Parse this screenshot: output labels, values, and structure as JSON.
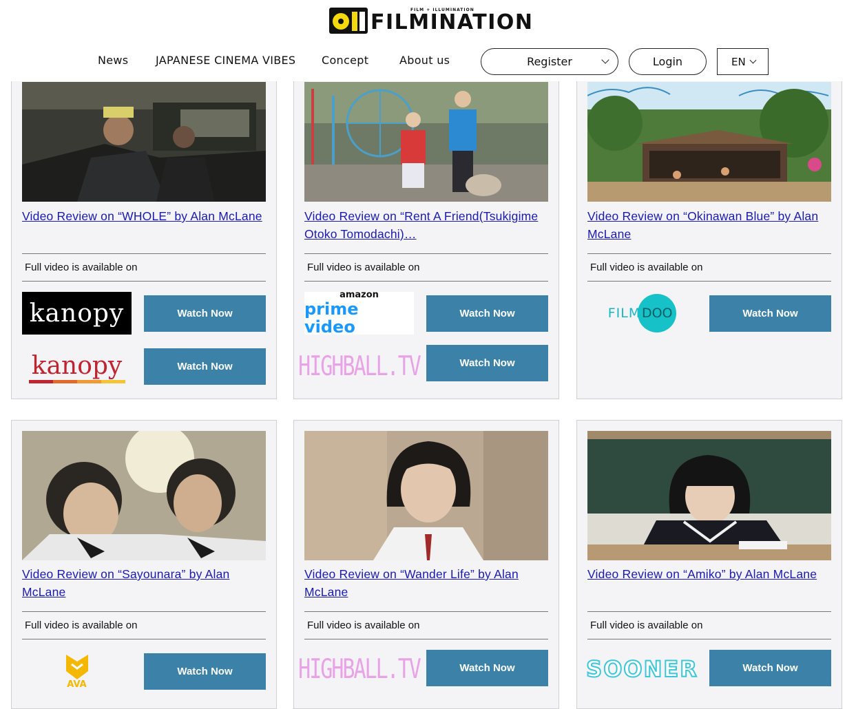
{
  "header": {
    "logo_sub": "FILM + ILLUMINATION",
    "logo_main": "FILMINATION",
    "nav": [
      "News",
      "JAPANESE CINEMA VIBES",
      "Concept",
      "About us"
    ],
    "register_label": "Register",
    "login_label": "Login",
    "lang_label": "EN"
  },
  "cards": [
    {
      "title": "Video Review on “WHOLE” by Alan McLane",
      "avail": "Full video is available on",
      "providers": [
        {
          "name": "kanopy",
          "label": "kanopy",
          "watch": "Watch Now"
        },
        {
          "name": "kanopy",
          "label": "kanopy",
          "watch": "Watch Now"
        }
      ]
    },
    {
      "title": "Video Review on “Rent A Friend(Tsukigime Otoko Tomodachi)…",
      "avail": "Full video is available on",
      "providers": [
        {
          "name": "prime video",
          "label_top": "amazon",
          "label": "prime video",
          "watch": "Watch Now"
        },
        {
          "name": "HIGHBALL.TV",
          "label": "HIGHBALL.TV",
          "watch": "Watch Now"
        }
      ]
    },
    {
      "title": "Video Review on “Okinawan Blue” by Alan McLane",
      "avail": "Full video is available on",
      "providers": [
        {
          "name": "FILMDOO",
          "label_a": "FILM",
          "label_b": "DOO",
          "watch": "Watch Now"
        }
      ]
    },
    {
      "title": "Video Review on “Sayounara” by Alan McLane",
      "avail": "Full video is available on",
      "providers": [
        {
          "name": "AVA",
          "label": "AVA",
          "watch": "Watch Now"
        }
      ]
    },
    {
      "title": "Video Review on “Wander Life” by Alan McLane",
      "avail": "Full video is available on",
      "providers": [
        {
          "name": "HIGHBALL.TV",
          "label": "HIGHBALL.TV",
          "watch": "Watch Now"
        }
      ]
    },
    {
      "title": "Video Review on “Amiko” by Alan McLane",
      "avail": "Full video is available on",
      "providers": [
        {
          "name": "SOONER",
          "label": "SOONER",
          "watch": "Watch Now"
        }
      ]
    }
  ],
  "colors": {
    "accent": "#3b81a8",
    "link": "#1a1ab0",
    "card_bg": "#f4f4f6",
    "logo_yellow": "#f5d90a"
  }
}
